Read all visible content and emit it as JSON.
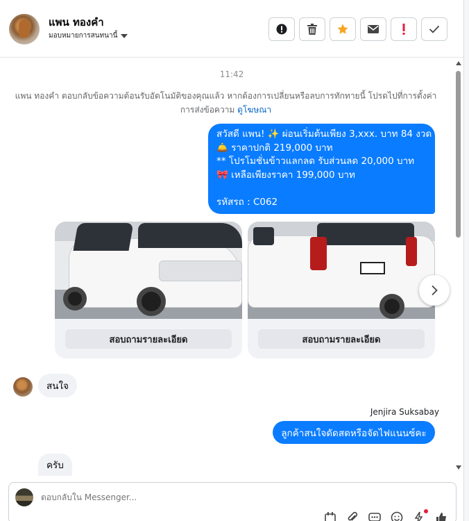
{
  "header": {
    "name": "แพน ทองคำ",
    "assign_label": "มอบหมายการสนทนานี้",
    "actions": [
      {
        "icon": "alert-circle-icon"
      },
      {
        "icon": "trash-icon"
      },
      {
        "icon": "star-icon",
        "color": "#f5a623"
      },
      {
        "icon": "mail-icon"
      },
      {
        "icon": "exclamation-icon",
        "color": "#e41e3f"
      },
      {
        "icon": "check-icon"
      }
    ]
  },
  "conversation": {
    "time": "11:42",
    "notice_text": "แพน ทองคำ ตอบกลับข้อความต้อนรับอัตโนมัติของคุณแล้ว หากต้องการเปลี่ยนหรือลบการทักทายนี้ โปรดไปที่การตั้งค่าการส่งข้อความ",
    "notice_link": "ดูโฆษณา",
    "outgoing_message": {
      "lines": [
        "สวัสดี แพน! ✨  ผ่อนเริ่มต้นเพียง 3,xxx. บาท 84 งวด",
        "🛎️ ราคาปกติ 219,000 บาท",
        "** โปรโมชั่นข้าวแลกลด รับส่วนลด 20,000 บาท",
        "🎀  เหลือเพียงราคา 199,000 บาท",
        "",
        " รหัสรถ : C062"
      ],
      "color": "#0a7cff"
    },
    "cards": [
      {
        "button_label": "สอบถามรายละเอียด"
      },
      {
        "button_label": "สอบถามรายละเอียด"
      }
    ],
    "incoming_1": "สนใจ",
    "sender_name": "Jenjira Suksabay",
    "outgoing_2": "ลูกค้าสนใจดัดสดหรือจัดไฟแนนซ์คะ",
    "incoming_2": "ครับ"
  },
  "composer": {
    "placeholder": "ตอบกลับใน Messenger..."
  }
}
